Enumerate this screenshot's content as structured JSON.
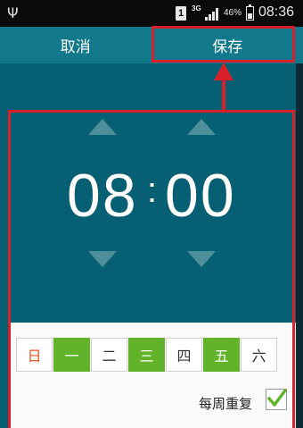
{
  "status_bar": {
    "usb_icon": "usb-icon",
    "sim_label": "1",
    "network_label": "3G",
    "battery_percent": "46%",
    "time": "08:36"
  },
  "action_bar": {
    "cancel_label": "取消",
    "save_label": "保存"
  },
  "time_picker": {
    "hour": "08",
    "separator": ":",
    "minute": "00"
  },
  "days": [
    {
      "label": "日",
      "selected": false
    },
    {
      "label": "一",
      "selected": true
    },
    {
      "label": "二",
      "selected": false
    },
    {
      "label": "三",
      "selected": true
    },
    {
      "label": "四",
      "selected": false
    },
    {
      "label": "五",
      "selected": true
    },
    {
      "label": "六",
      "selected": false
    }
  ],
  "weekly_repeat": {
    "label": "每周重复",
    "checked": true
  },
  "colors": {
    "action_bar": "#12788c",
    "panel": "#075f73",
    "selected_day": "#62b32a",
    "sunday_text": "#e8531d",
    "annotation": "#d8202a"
  }
}
